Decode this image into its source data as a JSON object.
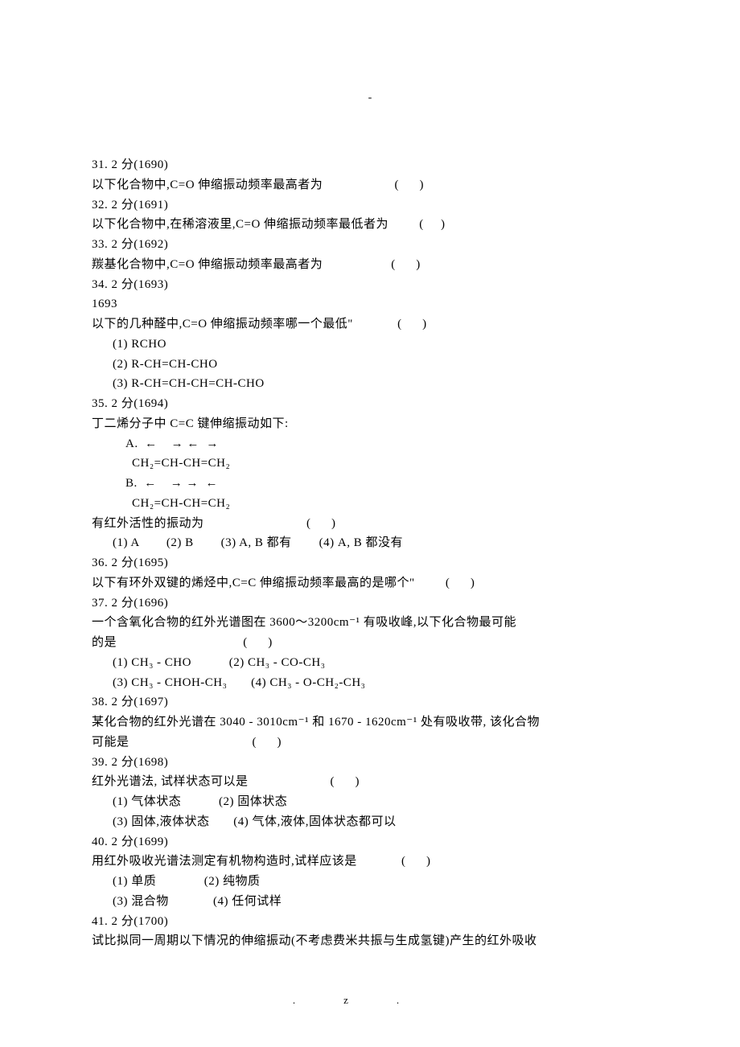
{
  "top_dash": "-",
  "q31": {
    "header": "31. 2 分(1690)",
    "text": "以下化合物中,C=O 伸缩振动频率最高者为                     (      )"
  },
  "q32": {
    "header": "32. 2 分(1691)",
    "text": "以下化合物中,在稀溶液里,C=O 伸缩振动频率最低者为         (     )"
  },
  "q33": {
    "header": "33. 2 分(1692)",
    "text": "羰基化合物中,C=O 伸缩振动频率最高者为                    (      )"
  },
  "q34": {
    "header": "34. 2 分(1693)",
    "id": "1693",
    "text": "以下的几种醛中,C=O 伸缩振动频率哪一个最低\"             (      )",
    "opt1": "(1) RCHO",
    "opt2": "(2) R-CH=CH-CHO",
    "opt3": "(3) R-CH=CH-CH=CH-CHO"
  },
  "q35": {
    "header": "35. 2 分(1694)",
    "intro": "丁二烯分子中 C=C 键伸缩振动如下:",
    "a_label": "A.  ←    → ←  →",
    "a_formula": "CH₂=CH-CH=CH₂",
    "b_label": "B.  ←    → →  ←",
    "b_formula": "CH₂=CH-CH=CH₂",
    "question": "有红外活性的振动为                              (      )",
    "opts": "(1) A        (2) B        (3) A, B 都有        (4) A, B 都没有"
  },
  "q36": {
    "header": "36. 2 分(1695)",
    "text": "以下有环外双键的烯烃中,C=C 伸缩振动频率最高的是哪个\"         (      )"
  },
  "q37": {
    "header": "37. 2 分(1696)",
    "line1": "一个含氧化合物的红外光谱图在 3600～3200cm⁻¹ 有吸收峰,以下化合物最可能",
    "line2": "的是                                     (      )",
    "opts1": "(1) CH₃ - CHO           (2) CH₃ - CO-CH₃",
    "opts2": "(3) CH₃ - CHOH-CH₃       (4) CH₃ - O-CH₂-CH₃"
  },
  "q38": {
    "header": "38. 2 分(1697)",
    "line1": "某化合物的红外光谱在 3040 - 3010cm⁻¹ 和 1670 - 1620cm⁻¹ 处有吸收带, 该化合物",
    "line2": "可能是                                    (      )"
  },
  "q39": {
    "header": "39. 2 分(1698)",
    "text": "红外光谱法, 试样状态可以是                        (      )",
    "opts1": "(1) 气体状态           (2) 固体状态",
    "opts2": "(3) 固体,液体状态       (4) 气体,液体,固体状态都可以"
  },
  "q40": {
    "header": "40. 2 分(1699)",
    "text": "用红外吸收光谱法测定有机物构造时,试样应该是             (      )",
    "opts1": "(1) 单质              (2) 纯物质",
    "opts2": "(3) 混合物             (4) 任何试样"
  },
  "q41": {
    "header": "41. 2 分(1700)",
    "text": "试比拟同一周期以下情况的伸缩振动(不考虑费米共振与生成氢键)产生的红外吸收"
  },
  "footer_left": ".",
  "footer_right": "z."
}
